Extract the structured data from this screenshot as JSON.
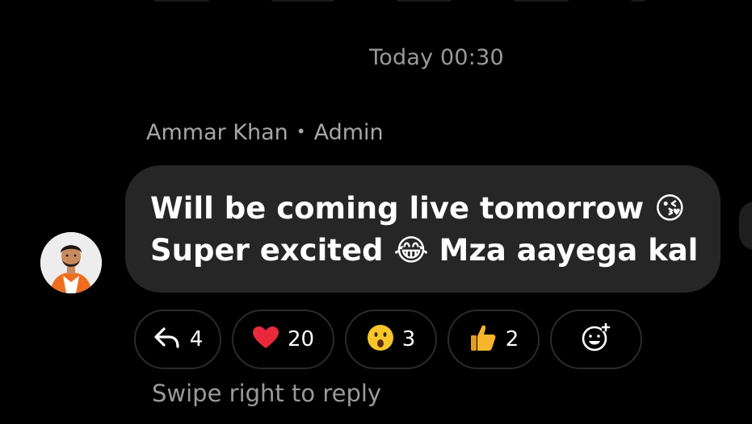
{
  "chat": {
    "timestamp": "Today 00:30",
    "sender": {
      "name": "Ammar Khan",
      "separator": "•",
      "role": "Admin"
    },
    "message": {
      "line1": "Will be coming live tomorrow 😘",
      "line2": "Super excited 😂 Mza aayega kal"
    },
    "reactions": [
      {
        "icon": "reply-icon",
        "count": "4"
      },
      {
        "icon": "heart-icon",
        "emoji": "❤️",
        "count": "20"
      },
      {
        "icon": "surprised-face-icon",
        "emoji": "😮",
        "count": "3"
      },
      {
        "icon": "thumbs-up-icon",
        "emoji": "👍",
        "count": "2"
      },
      {
        "icon": "add-reaction-icon"
      }
    ],
    "hint": "Swipe right to reply"
  },
  "colors": {
    "background": "#000000",
    "bubble": "#262626",
    "muted_text": "#9a9a9a",
    "chip_border": "#2b2b2b",
    "heart": "#e8293b",
    "avatar_shirt": "#f06d1f"
  }
}
